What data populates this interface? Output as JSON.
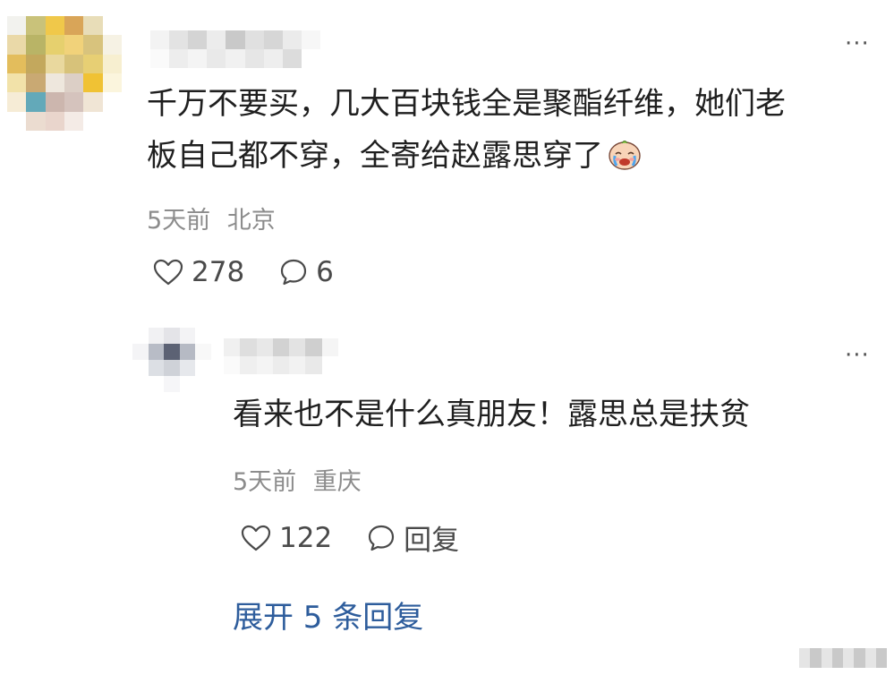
{
  "main_comment": {
    "text_line1": "千万不要买，几大百块钱全是聚酯纤维，她们老",
    "text_line2": "板自己都不穿，全寄给赵露思穿了",
    "time": "5天前",
    "location": "北京",
    "likes": "278",
    "replies": "6",
    "emoji": "crying-face-emoji"
  },
  "reply_comment": {
    "text": "看来也不是什么真朋友！露思总是扶贫",
    "time": "5天前",
    "location": "重庆",
    "likes": "122",
    "reply_label": "回复"
  },
  "expand_label": "展开 5 条回复",
  "more_label": "···",
  "colors": {
    "text": "#1f1f1f",
    "meta": "#8c8c8c",
    "link": "#2e5d9c",
    "icon": "#4a4a4a"
  },
  "icons": [
    "heart-outline-icon",
    "comment-bubble-icon",
    "more-dots-icon"
  ]
}
